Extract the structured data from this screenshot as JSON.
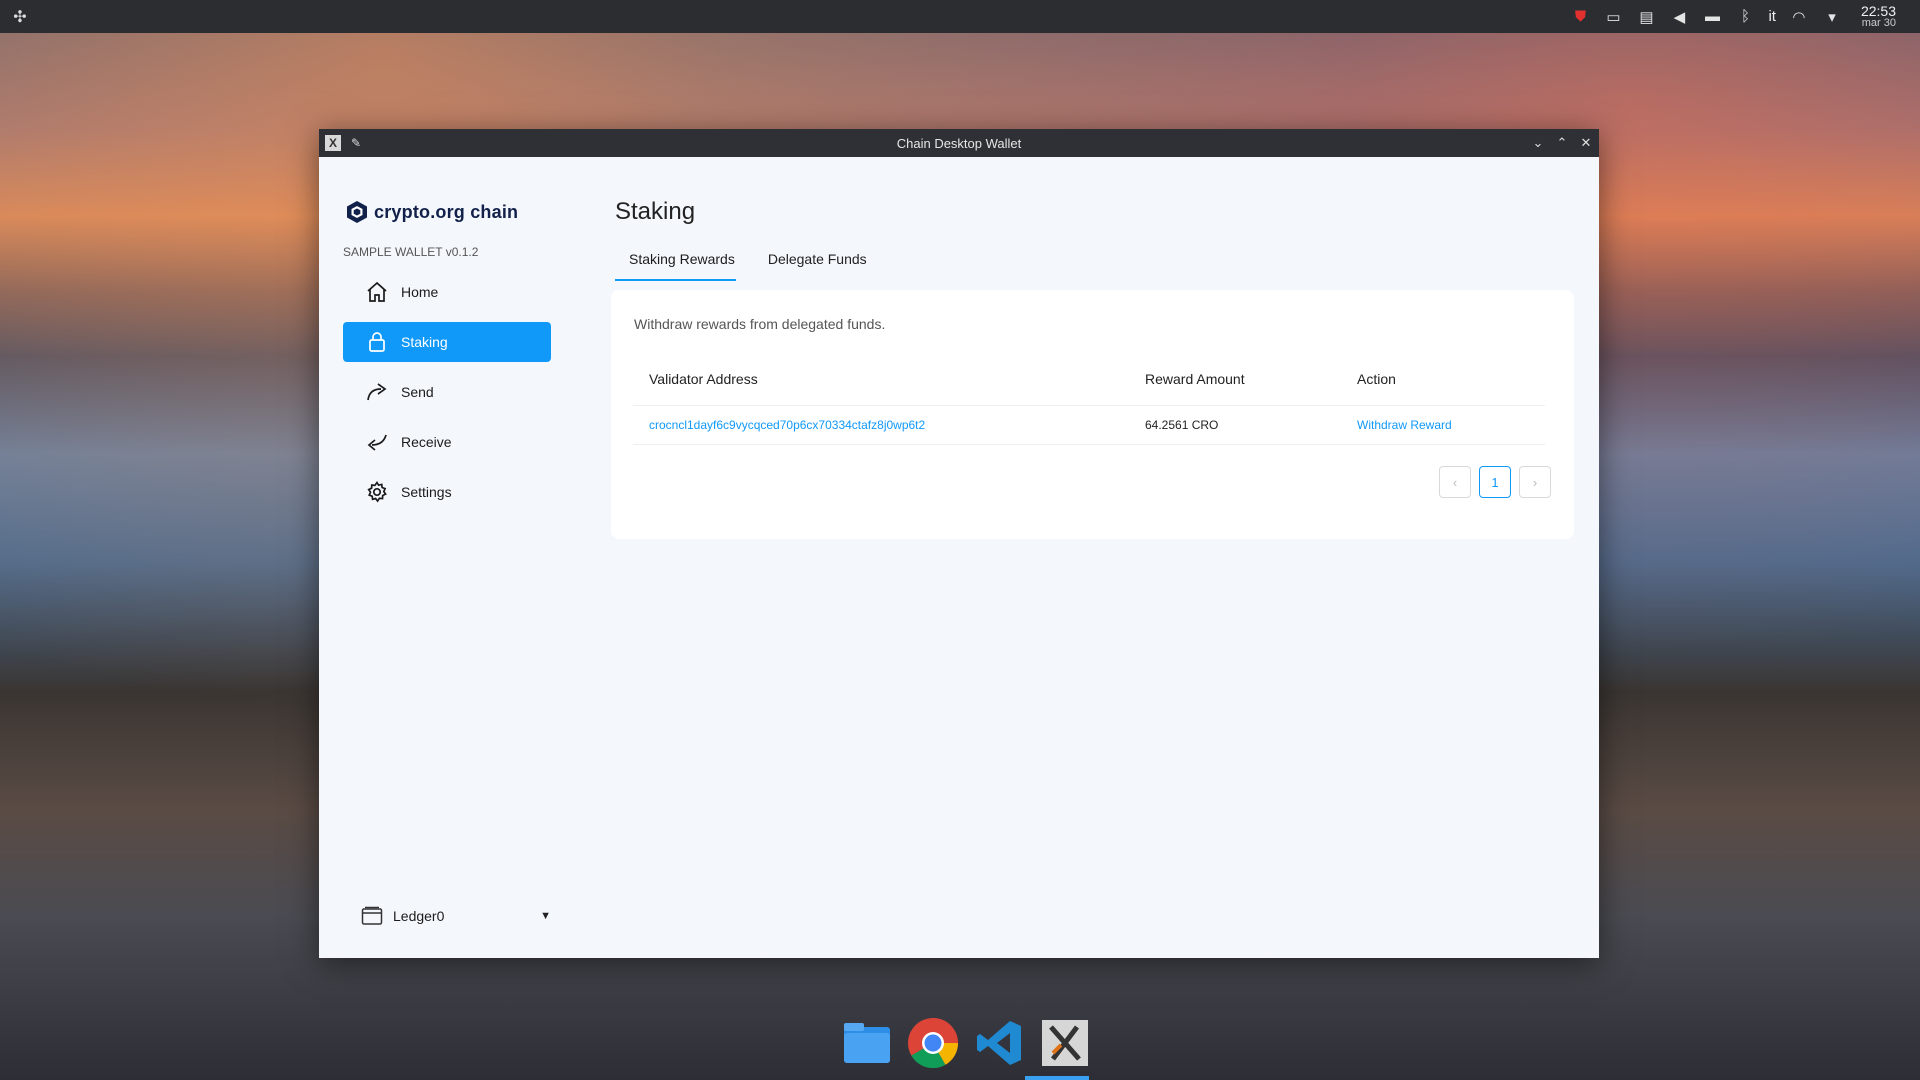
{
  "system": {
    "keyboard_layout": "it",
    "clock_time": "22:53",
    "clock_date": "mar 30"
  },
  "window": {
    "title": "Chain Desktop Wallet"
  },
  "sidebar": {
    "logo_text": "crypto.org chain",
    "version": "SAMPLE WALLET v0.1.2",
    "items": [
      {
        "label": "Home",
        "icon": "home-icon"
      },
      {
        "label": "Staking",
        "icon": "lock-icon"
      },
      {
        "label": "Send",
        "icon": "send-arrow-icon"
      },
      {
        "label": "Receive",
        "icon": "receive-arrow-icon"
      },
      {
        "label": "Settings",
        "icon": "gear-icon"
      }
    ],
    "active_item": "Staking",
    "wallet": "Ledger0"
  },
  "main": {
    "title": "Staking",
    "tabs": [
      {
        "label": "Staking Rewards"
      },
      {
        "label": "Delegate Funds"
      }
    ],
    "active_tab": "Staking Rewards",
    "description": "Withdraw rewards from delegated funds.",
    "table": {
      "headers": [
        "Validator Address",
        "Reward Amount",
        "Action"
      ],
      "rows": [
        {
          "validator": "crocncl1dayf6c9vycqced70p6cx70334ctafz8j0wp6t2",
          "reward": "64.2561 CRO",
          "action": "Withdraw Reward"
        }
      ]
    },
    "pagination": {
      "prev": "‹",
      "current_page": "1",
      "next": "›"
    }
  },
  "colors": {
    "accent": "#1199fa",
    "sidebar_bg": "#f4f8fc",
    "brand_text": "#12214a"
  }
}
